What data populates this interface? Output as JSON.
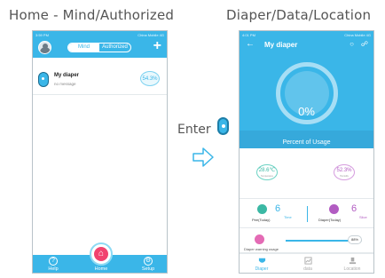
{
  "captions": {
    "left": "Home - Mind/Authorized",
    "right": "Diaper/Data/Location"
  },
  "transition": {
    "label": "Enter"
  },
  "home_screen": {
    "statusbar": {
      "time": "3:59 PM",
      "right": "China Mobile 4G"
    },
    "segment": {
      "mind": "Mind",
      "authorized": "Authorized"
    },
    "device": {
      "name": "My diaper",
      "message": "no message",
      "usage": "54.3%"
    },
    "tabs": {
      "help": "Help",
      "home": "Home",
      "setup": "Setup"
    }
  },
  "detail_screen": {
    "statusbar": {
      "time": "4:01 PM",
      "right": "China Mobile 4G"
    },
    "title": "My diaper",
    "gauge": {
      "value": "0%",
      "label": "Percent of Usage",
      "level": 0
    },
    "temperature": {
      "value": "28.6℃",
      "sub": "Temperature"
    },
    "humidity": {
      "value": "52.3%",
      "sub": "Humidity"
    },
    "pee": {
      "count": "6",
      "unit": "Time",
      "label": "Pee(Today)"
    },
    "diaper": {
      "count": "6",
      "unit": "Slice",
      "label": "Diaper(Today)"
    },
    "warning": {
      "label": "Diaper warning usage",
      "value": "88%",
      "level": 0.88
    },
    "tabs": {
      "diaper": "Diaper",
      "data": "data",
      "location": "Location"
    }
  },
  "colors": {
    "primary": "#3ab6e8",
    "home": "#f1436f",
    "teal": "#3bb8a4",
    "purple": "#b25cc2",
    "pink": "#e46bb5"
  },
  "icons": [
    "avatar",
    "plus-icon",
    "diaper-device-icon",
    "help-icon",
    "home-icon",
    "setup-icon",
    "back-arrow-icon",
    "chat-icon",
    "share-icon",
    "drop-icon",
    "diaper-icon",
    "warning-icon",
    "data-icon",
    "location-icon",
    "arrow-right-icon"
  ]
}
